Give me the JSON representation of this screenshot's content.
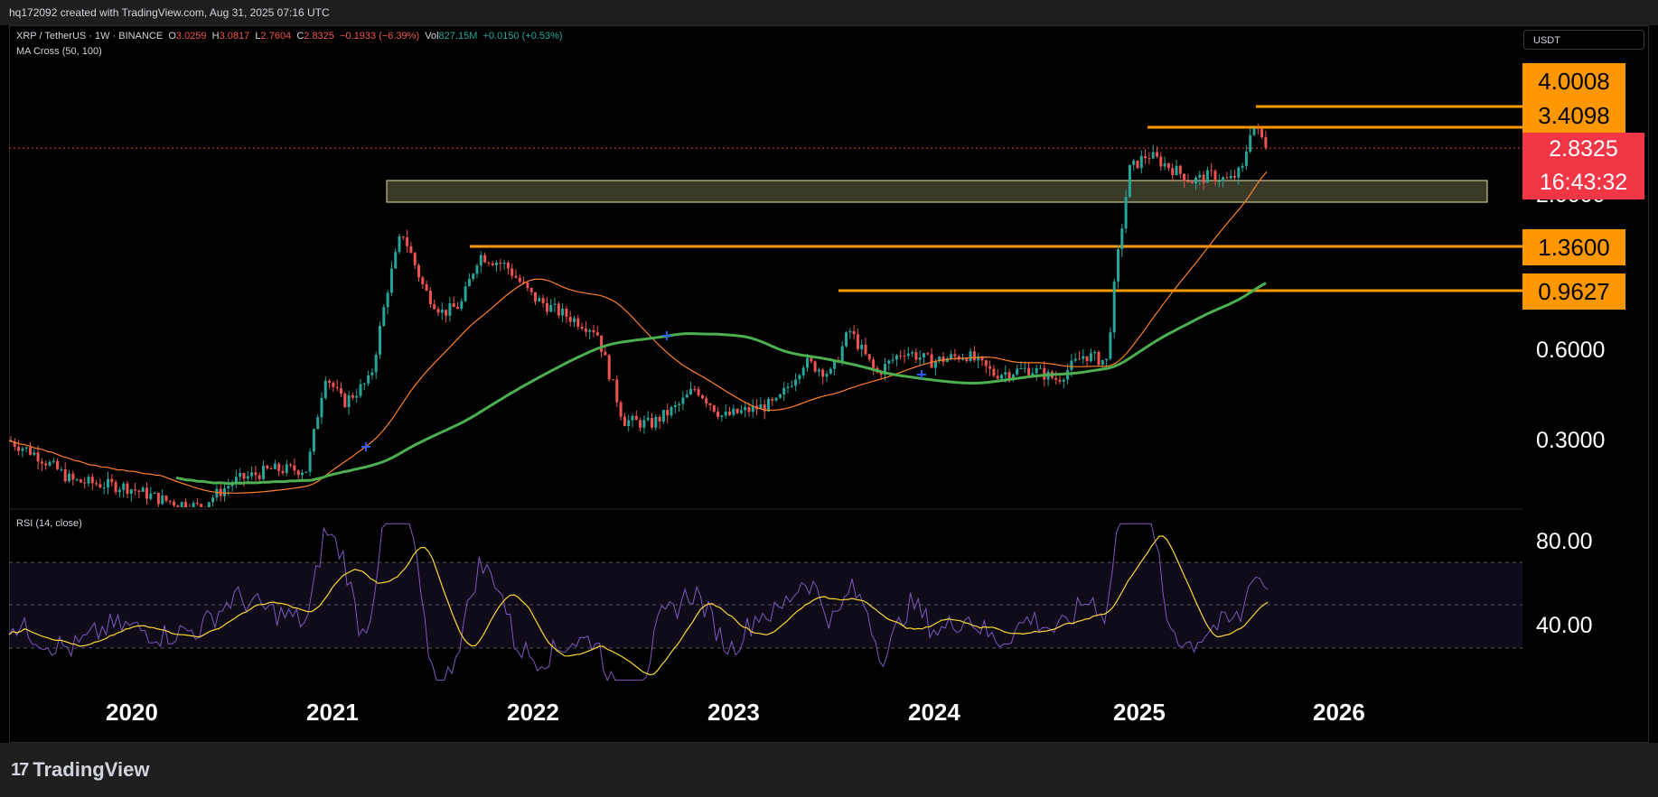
{
  "header": {
    "caption": "hq172092 created with TradingView.com, Aug 31, 2025 07:16 UTC"
  },
  "legend": {
    "symbol": "XRP / TetherUS · 1W · BINANCE",
    "open_label": "O",
    "open": "3.0259",
    "high_label": "H",
    "high": "3.0817",
    "low_label": "L",
    "low": "2.7604",
    "close_label": "C",
    "close": "2.8325",
    "change": "−0.1933 (−6.39%)",
    "vol_label": "Vol",
    "vol": "827.15M",
    "vol_change": "+0.0150 (+0.53%)",
    "indicator": "MA Cross (50, 100)",
    "rsi": "RSI (14, close)"
  },
  "currency_button": "USDT",
  "price_levels": {
    "level_4": "4.0008",
    "level_3": "3.4098",
    "current_price": "2.8325",
    "countdown": "16:43:32",
    "partial": "2.0000",
    "level_2": "1.3600",
    "level_1": "0.9627"
  },
  "price_axis": {
    "ticks": [
      "0.6000",
      "0.3000"
    ]
  },
  "rsi_axis": {
    "ticks": [
      "80.00",
      "40.00"
    ]
  },
  "chart_data": {
    "type": "line",
    "series_type": "candlestick",
    "price_scale": "log",
    "x": [
      "2020",
      "2021",
      "2022",
      "2023",
      "2024",
      "2025",
      "2026"
    ],
    "price_close_approx": [
      0.19,
      0.22,
      0.83,
      0.35,
      0.62,
      2.25,
      2.83
    ],
    "ma_slow_approx": [
      0.25,
      0.26,
      0.65,
      0.6,
      0.55,
      1.0,
      1.37
    ],
    "ma_fast_approx": [
      0.23,
      0.22,
      0.75,
      0.4,
      0.6,
      1.5,
      2.2
    ],
    "horizontal_levels": [
      4.0008,
      3.4098,
      1.36,
      0.9627
    ],
    "resistance_zone": [
      2.0,
      2.5
    ],
    "current_price": 2.8325,
    "rsi": {
      "values_approx": [
        45,
        45,
        50,
        85,
        40,
        55,
        35,
        55,
        80,
        45,
        60,
        95,
        55,
        70,
        60
      ],
      "bands": [
        80,
        60,
        40
      ]
    },
    "colors": {
      "up": "#26a69a",
      "down": "#ef5350",
      "ma_slow": "#4caf50",
      "ma_fast": "#ff7f2a",
      "level": "#ff9800",
      "zone": "#e6e6a0",
      "rsi": "#7e57c2",
      "rsi_ma": "#fdd835"
    }
  }
}
